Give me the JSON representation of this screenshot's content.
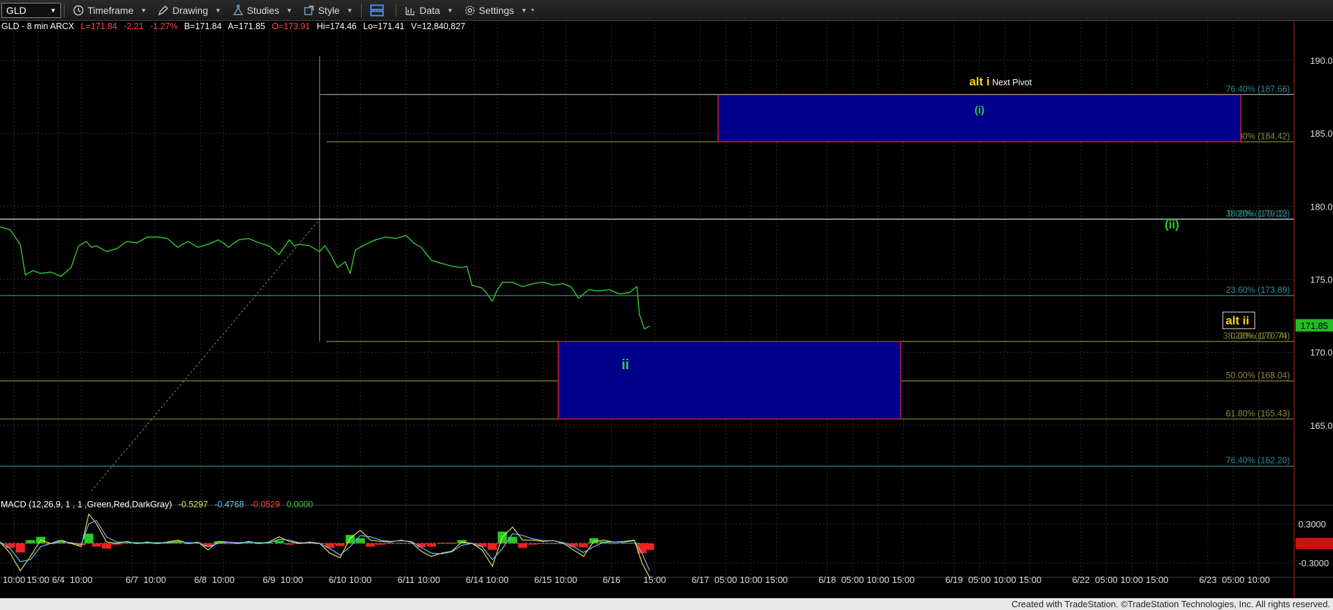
{
  "toolbar": {
    "symbol": "GLD",
    "items": [
      {
        "label": "Timeframe",
        "icon": "clock-icon"
      },
      {
        "label": "Drawing",
        "icon": "pen-icon"
      },
      {
        "label": "Studies",
        "icon": "flask-icon"
      },
      {
        "label": "Style",
        "icon": "style-icon"
      },
      {
        "label": "",
        "icon": "panels-icon"
      },
      {
        "label": "Data",
        "icon": "bar-chart-icon"
      },
      {
        "label": "Settings",
        "icon": "gear-icon"
      }
    ]
  },
  "header": {
    "title": "GLD - 8 min  ARCX",
    "last": "L=171.84",
    "change": "-2.21",
    "pct": "-1.27%",
    "bid": "B=171.84",
    "ask": "A=171.85",
    "open": "O=173.91",
    "high": "Hi=174.46",
    "low": "Lo=171.41",
    "volume": "V=12,840,827"
  },
  "macd_label": {
    "name": "MACD (12,26,9, 1 , 1 ,Green,Red,DarkGray)",
    "v1": "-0.5297",
    "v2": "-0.4768",
    "v3": "-0.0529",
    "v4": "0.0000"
  },
  "footer": "Created with TradeStation. ©TradeStation Technologies, Inc. All rights reserved.",
  "colors": {
    "price_line": "#33cc33",
    "box_fill": "#00008b",
    "box_border": "#cc2222",
    "fib_teal": "#2e8b8b",
    "fib_olive": "#8a8a3a",
    "label_yellow": "#ffd700",
    "wave_green": "#33cc33"
  },
  "chart_data": {
    "type": "line",
    "symbol": "GLD",
    "interval": "8 min",
    "ylim": [
      160,
      192
    ],
    "yticks": [
      165,
      170,
      175,
      180,
      185,
      190
    ],
    "last_price": "171.85",
    "x_tick_labels": [
      {
        "label": "10:00",
        "t": 0.55
      },
      {
        "label": "15:00",
        "t": 1.5
      },
      {
        "label": "6/4",
        "t": 2.3
      },
      {
        "label": "10:00",
        "t": 3.2
      },
      {
        "label": "6/7",
        "t": 5.2
      },
      {
        "label": "10:00",
        "t": 6.1
      },
      {
        "label": "6/8",
        "t": 7.9
      },
      {
        "label": "10:00",
        "t": 8.8
      },
      {
        "label": "6/9",
        "t": 10.6
      },
      {
        "label": "10:00",
        "t": 11.5
      },
      {
        "label": "6/10",
        "t": 13.3
      },
      {
        "label": "10:00",
        "t": 14.2
      },
      {
        "label": "6/11",
        "t": 16.0
      },
      {
        "label": "10:00",
        "t": 16.9
      },
      {
        "label": "6/14",
        "t": 18.7
      },
      {
        "label": "10:00",
        "t": 19.6
      },
      {
        "label": "6/15",
        "t": 21.4
      },
      {
        "label": "10:00",
        "t": 22.3
      },
      {
        "label": "6/16",
        "t": 24.1
      },
      {
        "label": "15:00",
        "t": 25.8
      },
      {
        "label": "6/17",
        "t": 27.6
      },
      {
        "label": "05:00",
        "t": 28.6
      },
      {
        "label": "10:00",
        "t": 29.6
      },
      {
        "label": "15:00",
        "t": 30.6
      },
      {
        "label": "6/18",
        "t": 32.6
      },
      {
        "label": "05:00",
        "t": 33.6
      },
      {
        "label": "10:00",
        "t": 34.6
      },
      {
        "label": "15:00",
        "t": 35.6
      },
      {
        "label": "6/19",
        "t": 37.6
      },
      {
        "label": "05:00",
        "t": 38.6
      },
      {
        "label": "10:00",
        "t": 39.6
      },
      {
        "label": "15:00",
        "t": 40.6
      },
      {
        "label": "6/22",
        "t": 42.6
      },
      {
        "label": "05:00",
        "t": 43.6
      },
      {
        "label": "10:00",
        "t": 44.6
      },
      {
        "label": "15:00",
        "t": 45.6
      },
      {
        "label": "6/23",
        "t": 47.6
      },
      {
        "label": "05:00",
        "t": 48.6
      },
      {
        "label": "10:00",
        "t": 49.6
      }
    ],
    "x_range": [
      0,
      51
    ],
    "series": [
      {
        "x": [
          0,
          0.4,
          0.8,
          1.0,
          1.3,
          1.6,
          2.0,
          2.4,
          2.8,
          3.1,
          3.4,
          3.6,
          3.8,
          4.2,
          4.6,
          5.0,
          5.4,
          5.8,
          6.2,
          6.6,
          7.0,
          7.4,
          7.8,
          8.2,
          8.6,
          8.8,
          9.0,
          9.4,
          9.8,
          10.2,
          10.6,
          11.0,
          11.4,
          11.6,
          11.8,
          12.2,
          12.6,
          12.8,
          13.0,
          13.3,
          13.6,
          13.8,
          14.0,
          14.4,
          14.8,
          15.2,
          15.6,
          16.0,
          16.3,
          16.6,
          17.0,
          17.4,
          17.8,
          18.2,
          18.4,
          18.6,
          19.0,
          19.2,
          19.4,
          19.6,
          19.8,
          20.2,
          20.6,
          21.0,
          21.4,
          21.8,
          22.2,
          22.5,
          22.8,
          23.2,
          23.6,
          24.0,
          24.4,
          24.8,
          25.1,
          25.2,
          25.4,
          25.6
        ],
        "y": [
          178.6,
          178.4,
          177.4,
          175.3,
          175.6,
          175.4,
          175.5,
          175.2,
          175.8,
          177.3,
          177.6,
          177.2,
          177.3,
          176.9,
          177.1,
          177.6,
          177.5,
          177.9,
          177.9,
          177.8,
          177.2,
          177.6,
          177.2,
          177.4,
          177.7,
          177.5,
          177.2,
          177.7,
          177.8,
          177.5,
          177.3,
          176.7,
          177.7,
          177.3,
          177.4,
          177.3,
          176.9,
          177.3,
          176.8,
          175.8,
          176.2,
          175.4,
          177.0,
          177.4,
          177.7,
          177.9,
          177.8,
          178.0,
          177.5,
          177.2,
          176.3,
          176.1,
          175.9,
          175.8,
          175.9,
          174.6,
          174.4,
          174.0,
          173.5,
          174.3,
          174.8,
          174.8,
          174.5,
          174.7,
          174.8,
          174.6,
          174.7,
          174.5,
          173.7,
          174.3,
          174.2,
          174.3,
          174.0,
          174.1,
          174.5,
          172.6,
          171.6,
          171.8
        ]
      }
    ],
    "fib_levels": [
      {
        "label": "76.40% (187.66)",
        "value": 187.66,
        "color": "teal"
      },
      {
        "label": "61.80% (184.42)",
        "value": 184.42,
        "color": "olive"
      },
      {
        "label": "38.20% (179.12)",
        "value": 179.12,
        "color": "teal"
      },
      {
        "label": "0.00% (179.12)",
        "value": 179.12,
        "color": "teal"
      },
      {
        "label": "23.60% (173.89)",
        "value": 173.89,
        "color": "teal"
      },
      {
        "label": "0.00% (170.74)",
        "value": 170.74,
        "color": "olive"
      },
      {
        "label": "38.20% (170.74)",
        "value": 170.74,
        "color": "olive"
      },
      {
        "label": "50.00% (168.04)",
        "value": 168.04,
        "color": "olive"
      },
      {
        "label": "61.80% (165.43)",
        "value": 165.43,
        "color": "olive"
      },
      {
        "label": "76.40% (162.20)",
        "value": 162.2,
        "color": "teal"
      }
    ],
    "target_boxes": [
      {
        "label": "(i)",
        "x0": 28.3,
        "x1": 48.9,
        "y0": 184.42,
        "y1": 187.66
      },
      {
        "label": "ii",
        "x0": 22.0,
        "x1": 35.5,
        "y0": 165.43,
        "y1": 170.74
      }
    ],
    "annotations": [
      {
        "text": "alt i",
        "x": 38.2,
        "y": 188.3,
        "color": "yellow"
      },
      {
        "text": "Next Pivot",
        "x": 39.1,
        "y": 188.3,
        "color": "white"
      },
      {
        "text": "(ii)",
        "x": 45.9,
        "y": 178.5,
        "color": "green"
      },
      {
        "text": "alt ii",
        "x": 48.3,
        "y": 171.9,
        "color": "yellow"
      }
    ],
    "macd": {
      "ylim": [
        -0.5,
        0.5
      ],
      "yticks": [
        0.3,
        -0.3
      ],
      "ytick_labels": [
        "0.3000",
        "-0.3000"
      ],
      "macd_x": [
        0,
        0.4,
        0.8,
        1.2,
        1.6,
        2.0,
        2.4,
        2.8,
        3.2,
        3.5,
        3.8,
        4.2,
        4.6,
        5.0,
        5.4,
        5.8,
        6.2,
        6.6,
        7.0,
        7.4,
        7.8,
        8.2,
        8.6,
        9.0,
        9.4,
        9.8,
        10.2,
        10.6,
        11.0,
        11.4,
        11.8,
        12.2,
        12.6,
        13.0,
        13.4,
        13.8,
        14.2,
        14.6,
        15.0,
        15.4,
        15.8,
        16.2,
        16.6,
        17.0,
        17.4,
        17.8,
        18.2,
        18.6,
        19.0,
        19.4,
        19.8,
        20.2,
        20.6,
        21.0,
        21.4,
        21.8,
        22.2,
        22.6,
        23.0,
        23.4,
        23.8,
        24.2,
        24.6,
        25.0,
        25.3,
        25.6
      ],
      "macd_y": [
        0.02,
        -0.15,
        -0.42,
        -0.2,
        0.05,
        0.0,
        0.05,
        0.0,
        -0.05,
        0.45,
        0.3,
        0.02,
        0.0,
        0.03,
        0.0,
        0.02,
        0.0,
        0.02,
        0.05,
        0.0,
        0.02,
        -0.1,
        0.03,
        0.02,
        0.0,
        0.03,
        0.0,
        0.02,
        0.1,
        0.03,
        0.0,
        0.02,
        0.0,
        -0.15,
        -0.22,
        0.08,
        0.2,
        0.05,
        0.03,
        0.02,
        0.05,
        0.02,
        -0.12,
        -0.2,
        -0.15,
        -0.12,
        0.02,
        0.0,
        -0.1,
        -0.35,
        0.1,
        0.25,
        0.05,
        0.05,
        0.03,
        0.04,
        0.0,
        -0.1,
        -0.2,
        0.03,
        0.05,
        0.02,
        0.03,
        0.05,
        -0.3,
        -0.52
      ],
      "signal_y": [
        0.02,
        -0.08,
        -0.28,
        -0.25,
        -0.05,
        0.0,
        0.03,
        0.01,
        -0.02,
        0.3,
        0.35,
        0.1,
        0.02,
        0.02,
        0.01,
        0.01,
        0.01,
        0.01,
        0.03,
        0.01,
        0.01,
        -0.05,
        0.0,
        0.02,
        0.01,
        0.02,
        0.01,
        0.01,
        0.06,
        0.05,
        0.01,
        0.01,
        0.0,
        -0.08,
        -0.18,
        -0.05,
        0.12,
        0.1,
        0.05,
        0.03,
        0.04,
        0.03,
        -0.06,
        -0.15,
        -0.16,
        -0.13,
        -0.03,
        0.0,
        -0.05,
        -0.25,
        -0.08,
        0.15,
        0.12,
        0.07,
        0.04,
        0.04,
        0.01,
        -0.05,
        -0.14,
        -0.05,
        0.02,
        0.02,
        0.02,
        0.04,
        -0.15,
        -0.42
      ],
      "hist_y": [
        0.0,
        -0.07,
        -0.14,
        0.05,
        0.1,
        0.0,
        0.02,
        -0.01,
        -0.03,
        0.15,
        -0.05,
        -0.08,
        -0.02,
        0.01,
        -0.01,
        0.01,
        -0.01,
        0.01,
        0.02,
        -0.01,
        0.01,
        -0.05,
        0.03,
        0.0,
        -0.01,
        0.01,
        -0.01,
        0.01,
        0.04,
        -0.02,
        -0.01,
        0.01,
        0.0,
        -0.07,
        -0.04,
        0.13,
        0.08,
        -0.05,
        -0.02,
        -0.01,
        0.01,
        -0.01,
        -0.06,
        -0.05,
        0.01,
        0.01,
        0.05,
        0.0,
        -0.05,
        -0.1,
        0.18,
        0.1,
        -0.07,
        -0.02,
        -0.01,
        0.0,
        -0.01,
        -0.05,
        -0.06,
        0.08,
        0.03,
        0.0,
        0.01,
        0.01,
        -0.15,
        -0.1
      ]
    }
  }
}
